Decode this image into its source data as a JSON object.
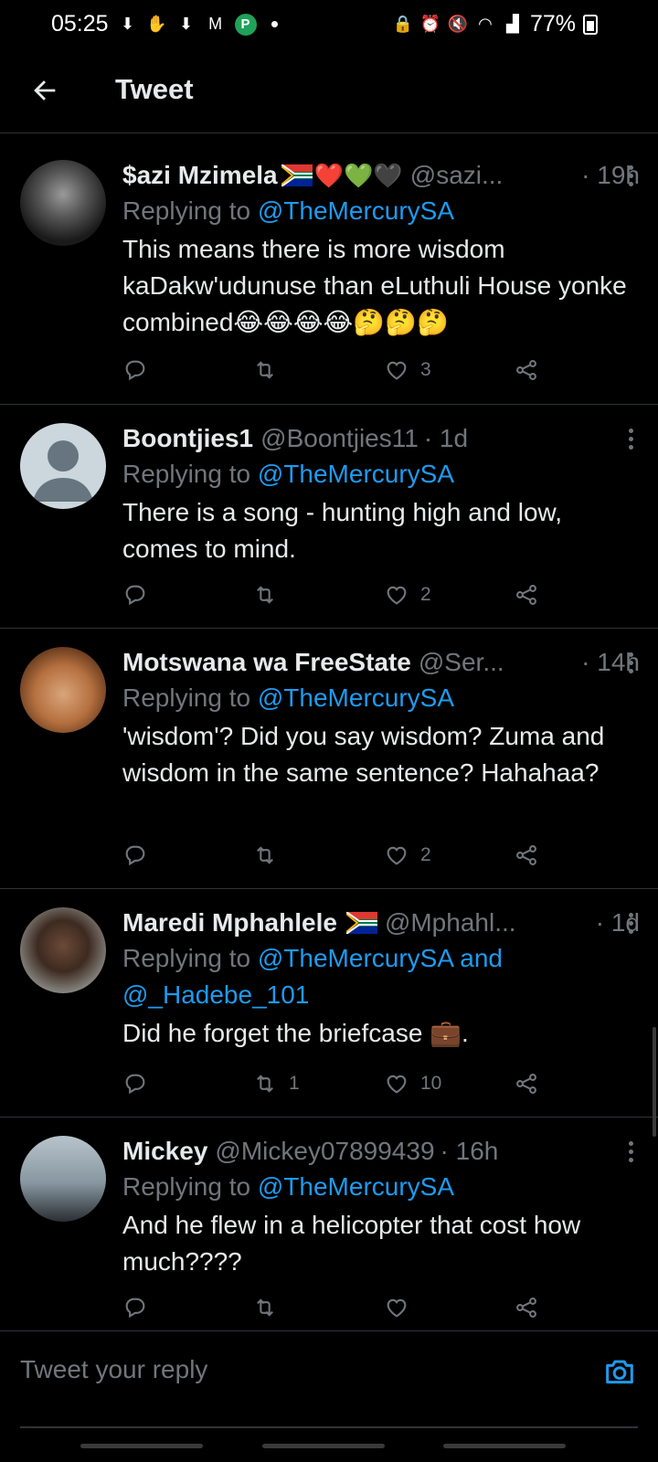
{
  "status_bar": {
    "time": "05:25",
    "battery": "77%",
    "left_icons": [
      "download-icon",
      "hand-icon",
      "download-icon",
      "gmail-icon",
      "p-app-icon",
      "dot-icon"
    ],
    "right_icons": [
      "lock-icon",
      "alarm-icon",
      "mute-icon",
      "wifi-icon",
      "signal-icon",
      "battery-icon"
    ]
  },
  "header": {
    "title": "Tweet"
  },
  "tweets": [
    {
      "name": "$azi Mzimela",
      "emoji_after_name": "❤️💚🖤",
      "flag": true,
      "handle": "@sazi...",
      "time": "· 19h",
      "replying_prefix": "Replying to ",
      "replying_to": "@TheMercurySA",
      "text": "This means there is more wisdom kaDakw'udunuse than eLuthuli House yonke combined😂😂😂😂🤔🤔🤔",
      "retweets": "",
      "likes": "3"
    },
    {
      "name": "Boontjies1",
      "emoji_after_name": "",
      "flag": false,
      "handle": "@Boontjies11",
      "time": "· 1d",
      "replying_prefix": "Replying to ",
      "replying_to": "@TheMercurySA",
      "text": "There is a song - hunting high and low, comes to mind.",
      "retweets": "",
      "likes": "2"
    },
    {
      "name": "Motswana wa FreeState",
      "emoji_after_name": "",
      "flag": false,
      "handle": "@Ser...",
      "time": "· 14h",
      "replying_prefix": "Replying to ",
      "replying_to": "@TheMercurySA",
      "text": "'wisdom'? Did you say wisdom? Zuma and wisdom in the same sentence? Hahahaa?",
      "retweets": "",
      "likes": "2"
    },
    {
      "name": "Maredi Mphahlele",
      "emoji_after_name": "",
      "flag": true,
      "handle": "@Mphahl...",
      "time": "· 1d",
      "replying_prefix": "Replying to ",
      "replying_to": "@TheMercurySA and @_Hadebe_101",
      "text": "Did he forget the briefcase 💼.",
      "retweets": "1",
      "likes": "10"
    },
    {
      "name": "Mickey",
      "emoji_after_name": "",
      "flag": false,
      "handle": "@Mickey07899439",
      "time": "· 16h",
      "replying_prefix": "Replying to ",
      "replying_to": "@TheMercurySA",
      "text": "And he flew in a helicopter that cost how much????",
      "retweets": "",
      "likes": ""
    }
  ],
  "reply_bar": {
    "placeholder": "Tweet your reply"
  },
  "colors": {
    "background": "#000000",
    "accent": "#1d9bf0",
    "muted": "#71767b",
    "text": "#e7e9ea"
  }
}
